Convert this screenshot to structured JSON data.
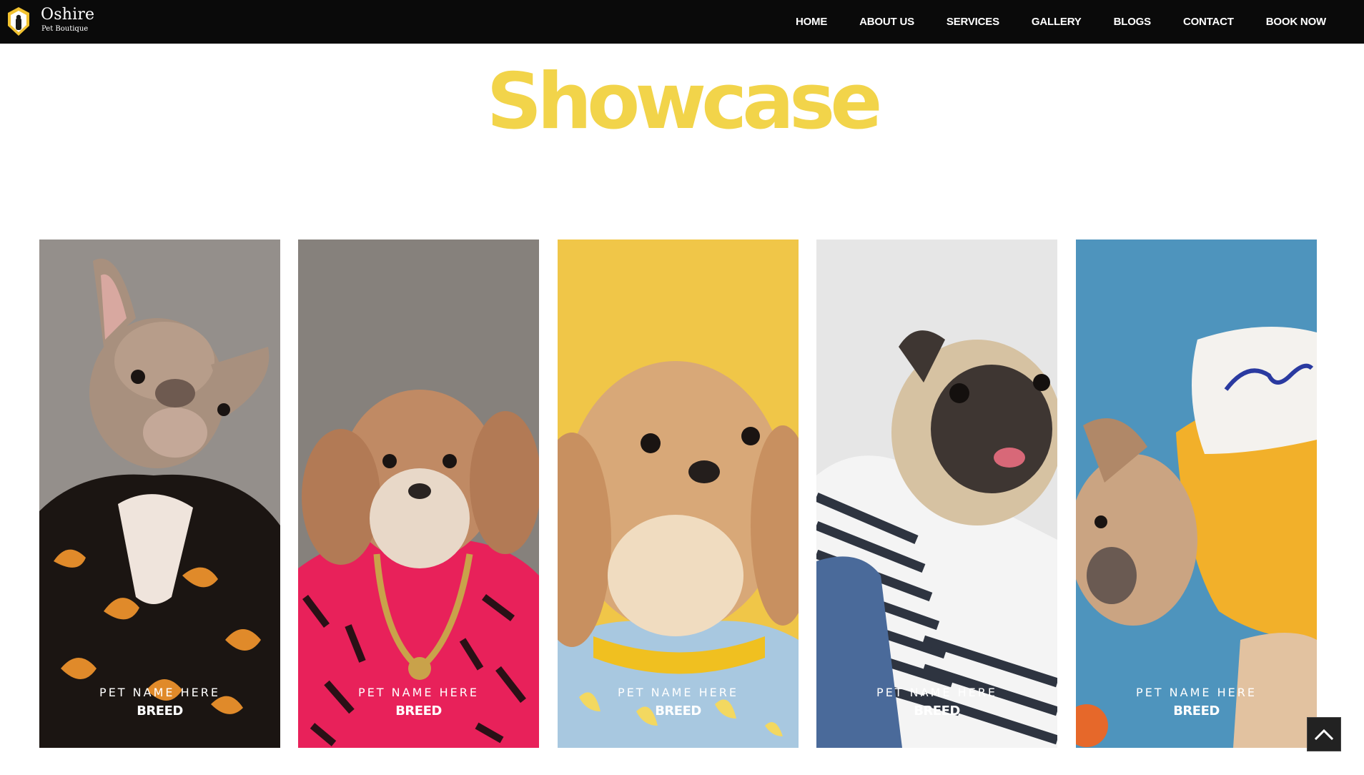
{
  "brand": {
    "name": "Oshire",
    "tagline": "Pet Boutique",
    "logo_icon": "paw-shield-icon",
    "accent": "#f2d44a"
  },
  "nav": {
    "items": [
      {
        "label": "HOME"
      },
      {
        "label": "ABOUT US"
      },
      {
        "label": "SERVICES"
      },
      {
        "label": "GALLERY"
      },
      {
        "label": "BLOGS"
      },
      {
        "label": "CONTACT"
      },
      {
        "label": "BOOK NOW"
      }
    ]
  },
  "page": {
    "title": "Showcase"
  },
  "showcase": {
    "cards": [
      {
        "name": "PET NAME HERE",
        "breed": "BREED",
        "photo": "french-bulldog-in-patterned-shirt",
        "bg": "#8d8884"
      },
      {
        "name": "PET NAME HERE",
        "breed": "BREED",
        "photo": "shih-tzu-in-pink-zebra-jacket-gold-chain",
        "bg": "#7e7874"
      },
      {
        "name": "PET NAME HERE",
        "breed": "BREED",
        "photo": "fluffy-dog-in-banana-shirt",
        "bg": "#f0c648"
      },
      {
        "name": "PET NAME HERE",
        "breed": "BREED",
        "photo": "pug-in-denim-striped-hoodie",
        "bg": "#e6e6e6"
      },
      {
        "name": "PET NAME HERE",
        "breed": "BREED",
        "photo": "bulldog-in-yellow-hoodie",
        "bg": "#4e94bd"
      }
    ]
  },
  "scroll_top": {
    "icon": "chevron-up-icon"
  }
}
